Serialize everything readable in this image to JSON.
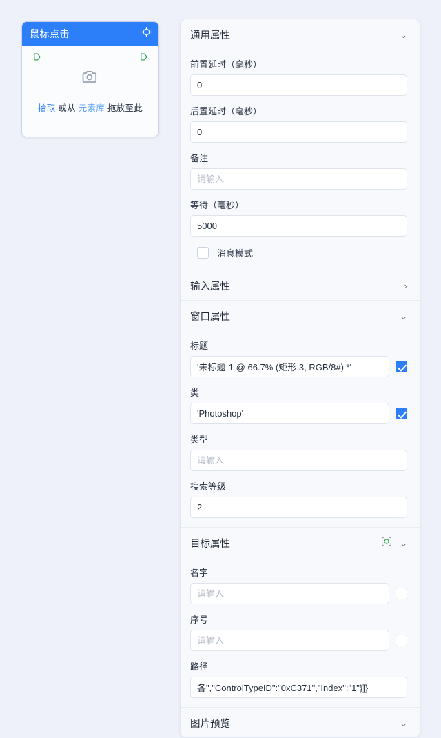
{
  "node_card": {
    "title": "鼠标点击",
    "header_icon": "crosshair-target-icon",
    "placeholder_icon": "camera-icon",
    "hint_pick": "拾取",
    "hint_mid": "或从",
    "hint_library": "元素库",
    "hint_tail": "拖放至此",
    "accent_color": "#2d7ff9",
    "port_color": "#2f9e52"
  },
  "panel": {
    "sections": [
      {
        "title": "通用属性",
        "state": "expanded",
        "chevron": "⌄"
      },
      {
        "title": "输入属性",
        "state": "collapsed",
        "chevron": "›"
      },
      {
        "title": "窗口属性",
        "state": "expanded",
        "chevron": "⌄"
      },
      {
        "title": "目标属性",
        "state": "expanded",
        "chevron": "⌄",
        "picker_icon": "element-picker-icon"
      },
      {
        "title": "图片预览",
        "state": "expanded",
        "chevron": "⌄"
      }
    ],
    "general": {
      "pre_delay_label": "前置延时（毫秒）",
      "pre_delay_value": "0",
      "post_delay_label": "后置延时（毫秒）",
      "post_delay_value": "0",
      "remark_label": "备注",
      "remark_value": "",
      "remark_placeholder": "请输入",
      "wait_label": "等待（毫秒）",
      "wait_value": "5000",
      "message_mode_label": "消息模式",
      "message_mode_checked": false
    },
    "window": {
      "title_label": "标题",
      "title_value": "'未标题-1 @ 66.7% (矩形 3, RGB/8#) *'",
      "title_checked": true,
      "class_label": "类",
      "class_value": "'Photoshop'",
      "class_checked": true,
      "type_label": "类型",
      "type_value": "",
      "type_placeholder": "请输入",
      "search_level_label": "搜索等级",
      "search_level_value": "2"
    },
    "target": {
      "name_label": "名字",
      "name_value": "",
      "name_placeholder": "请输入",
      "name_checked": false,
      "index_label": "序号",
      "index_value": "",
      "index_placeholder": "请输入",
      "index_checked": false,
      "path_label": "路径",
      "path_value": "各\",\"ControlTypeID\":\"0xC371\",\"Index\":\"1\"}]}"
    }
  }
}
